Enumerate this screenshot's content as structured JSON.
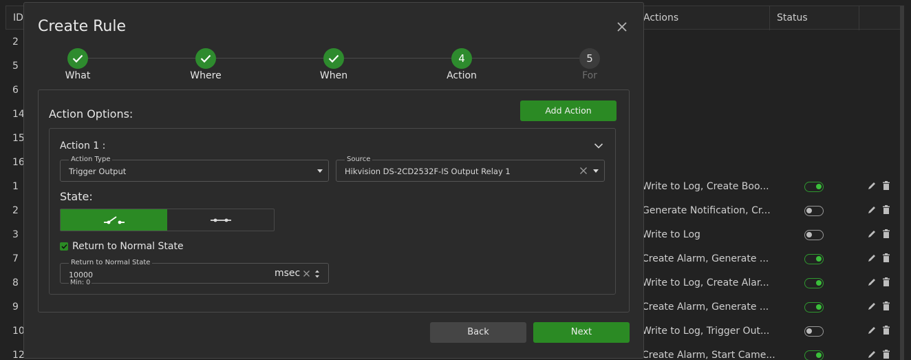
{
  "background_table": {
    "columns": {
      "id": "ID",
      "actions": "Actions",
      "status": "Status"
    },
    "rows": [
      {
        "id": "2",
        "actions": "",
        "status": ""
      },
      {
        "id": "5",
        "actions": "",
        "status": ""
      },
      {
        "id": "6",
        "actions": "",
        "status": ""
      },
      {
        "id": "14",
        "actions": "",
        "status": ""
      },
      {
        "id": "15",
        "actions": "",
        "status": ""
      },
      {
        "id": "16",
        "actions": "",
        "status": ""
      },
      {
        "id": "1",
        "actions": "Write to Log, Create Boo...",
        "status": "on"
      },
      {
        "id": "2",
        "actions": "Generate Notification, Cr...",
        "status": "off"
      },
      {
        "id": "3",
        "actions": "Write to Log",
        "status": "off"
      },
      {
        "id": "7",
        "actions": "Create Alarm, Generate ...",
        "status": "on"
      },
      {
        "id": "8",
        "actions": "Write to Log, Create Alar...",
        "status": "on"
      },
      {
        "id": "9",
        "actions": "Create Alarm, Generate ...",
        "status": "on"
      },
      {
        "id": "10",
        "actions": "Write to Log, Trigger Out...",
        "status": "off"
      },
      {
        "id": "12",
        "actions": "Create Alarm, Start Came...",
        "status": "on"
      }
    ]
  },
  "modal": {
    "title": "Create Rule",
    "steps": [
      {
        "label": "What",
        "state": "done",
        "number": "1"
      },
      {
        "label": "Where",
        "state": "done",
        "number": "2"
      },
      {
        "label": "When",
        "state": "done",
        "number": "3"
      },
      {
        "label": "Action",
        "state": "active",
        "number": "4"
      },
      {
        "label": "For",
        "state": "todo",
        "number": "5"
      }
    ],
    "action_options_label": "Action Options:",
    "add_action_label": "Add Action",
    "action": {
      "title": "Action 1 :",
      "action_type_label": "Action Type",
      "action_type_value": "Trigger Output",
      "source_label": "Source",
      "source_value": "Hikvision DS-2CD2532F-IS Output Relay 1",
      "state_label": "State:",
      "state_selected": "open",
      "return_normal_checkbox_label": "Return to Normal State",
      "return_normal_checked": true,
      "return_normal_field_label": "Return to Normal State",
      "return_normal_value": "10000",
      "return_normal_unit": "msec",
      "return_normal_min": "Min: 0"
    },
    "back_label": "Back",
    "next_label": "Next"
  },
  "colors": {
    "accent": "#2b8a24",
    "modal_bg": "#2b2b2b",
    "page_bg": "#1e1e1e"
  }
}
